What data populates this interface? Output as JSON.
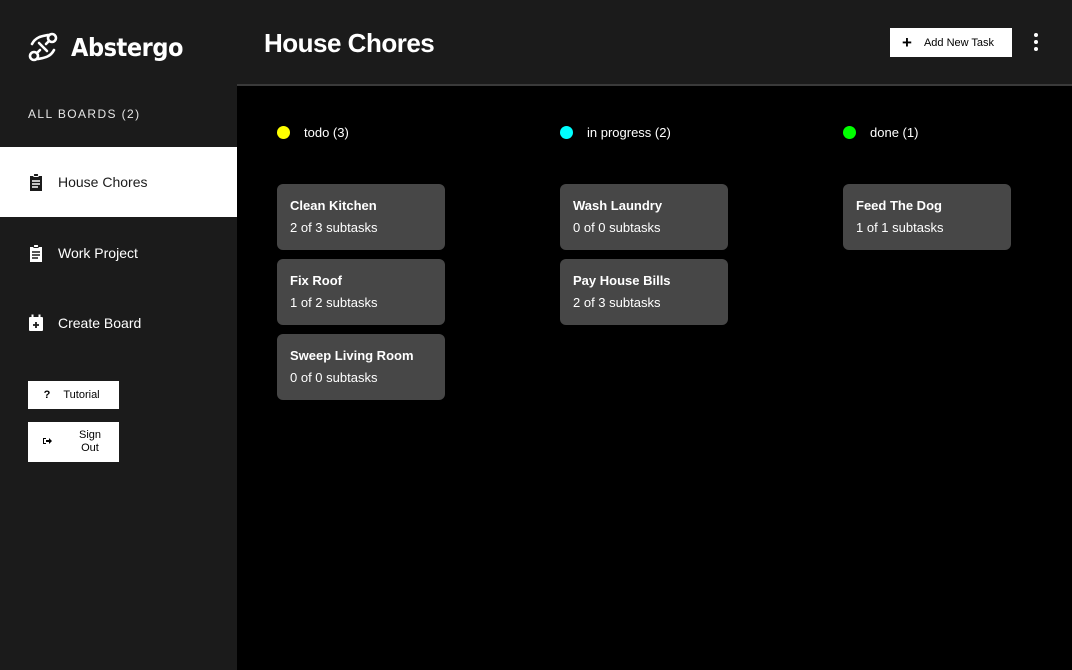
{
  "brand": {
    "name": "Abstergo"
  },
  "sidebar": {
    "boards_heading": "ALL BOARDS (2)",
    "items": [
      {
        "label": "House Chores",
        "icon": "clipboard-icon",
        "active": true
      },
      {
        "label": "Work Project",
        "icon": "clipboard-icon",
        "active": false
      },
      {
        "label": "Create Board",
        "icon": "calendar-plus-icon",
        "active": false
      }
    ],
    "tutorial_label": "Tutorial",
    "tutorial_icon": "?",
    "signout_label": "Sign Out"
  },
  "header": {
    "title": "House Chores",
    "add_task_label": "Add New Task"
  },
  "colors": {
    "todo": "#ffff00",
    "in_progress": "#00ffff",
    "done": "#00ff00",
    "card": "#474747",
    "sidebar": "#1b1b1b"
  },
  "columns": [
    {
      "label": "todo (3)",
      "color": "#ffff00",
      "cards": [
        {
          "title": "Clean Kitchen",
          "subtasks": "2 of 3 subtasks"
        },
        {
          "title": "Fix Roof",
          "subtasks": "1 of 2 subtasks"
        },
        {
          "title": "Sweep Living Room",
          "subtasks": "0 of 0 subtasks"
        }
      ]
    },
    {
      "label": "in progress (2)",
      "color": "#00ffff",
      "cards": [
        {
          "title": "Wash Laundry",
          "subtasks": "0 of 0 subtasks"
        },
        {
          "title": "Pay House Bills",
          "subtasks": "2 of 3 subtasks"
        }
      ]
    },
    {
      "label": "done (1)",
      "color": "#00ff00",
      "cards": [
        {
          "title": "Feed The Dog",
          "subtasks": "1 of 1 subtasks"
        }
      ]
    }
  ]
}
